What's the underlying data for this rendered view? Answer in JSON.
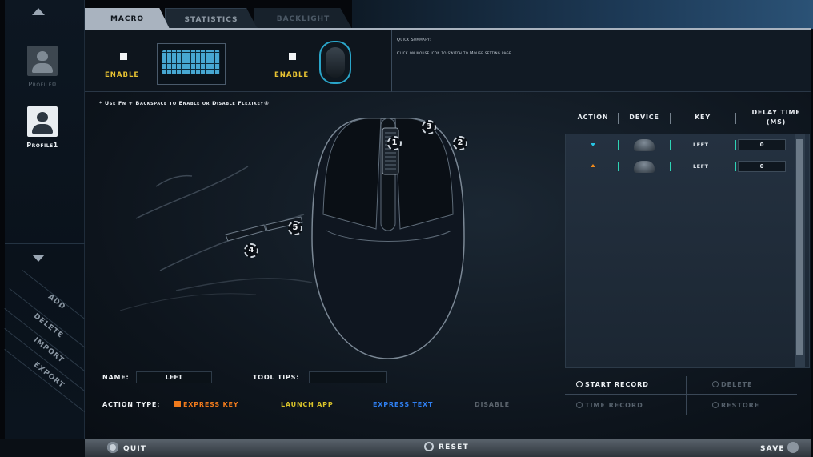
{
  "tabs": [
    {
      "label": "MACRO"
    },
    {
      "label": "STATISTICS"
    },
    {
      "label": "BACKLIGHT"
    }
  ],
  "sidebar": {
    "profiles": [
      {
        "label": "Profile0"
      },
      {
        "label": "Profile1"
      }
    ],
    "actions": [
      {
        "label": "ADD"
      },
      {
        "label": "DELETE"
      },
      {
        "label": "IMPORT"
      },
      {
        "label": "EXPORT"
      }
    ]
  },
  "devices": {
    "keyboard_enable_label": "ENABLE",
    "mouse_enable_label": "ENABLE"
  },
  "summary": {
    "title": "Quick Summary:",
    "text": "Click on mouse icon to switch to Mouse setting page."
  },
  "hint": "* Use Fn + Backspace to Enable or Disable Flexikey®",
  "mouse_buttons": [
    "1",
    "2",
    "3",
    "4",
    "5"
  ],
  "table": {
    "headers": {
      "action": "ACTION",
      "device": "DEVICE",
      "key": "KEY",
      "delay": "DELAY TIME (MS)"
    },
    "rows": [
      {
        "direction": "down",
        "key": "LEFT",
        "delay": "0"
      },
      {
        "direction": "up",
        "key": "LEFT",
        "delay": "0"
      }
    ]
  },
  "record": {
    "start": "START RECORD",
    "delete": "DELETE",
    "time": "TIME RECORD",
    "restore": "RESTORE"
  },
  "form": {
    "name_label": "NAME:",
    "name_value": "LEFT",
    "tooltips_label": "TOOL TIPS:",
    "tooltips_value": "",
    "action_type_label": "ACTION TYPE:",
    "types": [
      {
        "label": "EXPRESS KEY",
        "color": "#f07a1c"
      },
      {
        "label": "LAUNCH APP",
        "color": "#d8c22a"
      },
      {
        "label": "EXPRESS TEXT",
        "color": "#2f7ff0"
      },
      {
        "label": "DISABLE",
        "color": "#5a636c"
      }
    ]
  },
  "bottom": {
    "quit": "QUIT",
    "reset": "RESET",
    "save": "SAVE"
  },
  "colors": {
    "accent_cyan": "#27c4e3",
    "accent_yellow": "#e7c232",
    "accent_orange": "#f08a1b"
  }
}
